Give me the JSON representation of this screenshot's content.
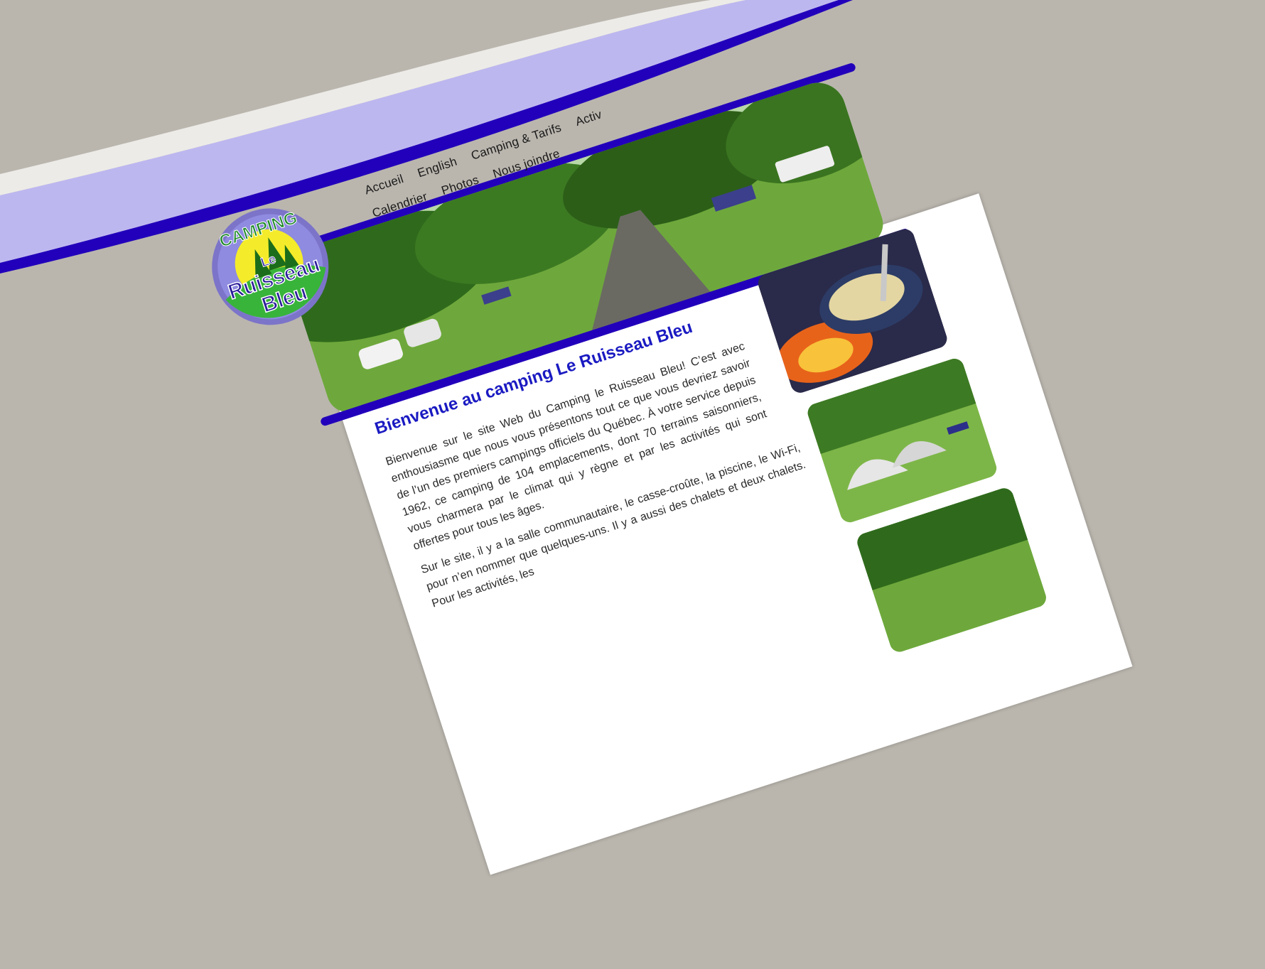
{
  "site": {
    "logo": {
      "word_top": "CAMPING",
      "word_le": "Le",
      "word_ruisseau": "Ruisseau",
      "word_bleu": "Bleu"
    },
    "nav": {
      "row1": [
        "Accueil",
        "English",
        "Camping & Tarifs",
        "Activ"
      ],
      "row2": [
        "Calendrier",
        "Photos",
        "Nous joindre"
      ]
    },
    "welcome": {
      "title": "Bienvenue au camping Le Ruisseau Bleu",
      "paragraph1": "Bienvenue sur le site Web du Camping le Ruisseau Bleu! C’est avec enthousiasme que nous vous présentons tout ce que vous devriez savoir de l’un des premiers campings officiels du Québec. À votre service depuis 1962, ce camping de 104 emplacements, dont 70 terrains saisonniers, vous charmera par le climat qui y règne et par les activités qui sont offertes pour tous les âges.",
      "paragraph2": "Sur le site, il y a la salle communautaire, le casse-croûte, la piscine, le Wi-Fi, pour n’en nommer que quelques-uns. Il y a aussi des chalets et deux chalets. Pour les activités, les"
    },
    "colors": {
      "accent_blue": "#2200bb",
      "lavender": "#bdb7f0",
      "title_blue": "#1a1ac2",
      "background": "#bab6ae"
    }
  }
}
